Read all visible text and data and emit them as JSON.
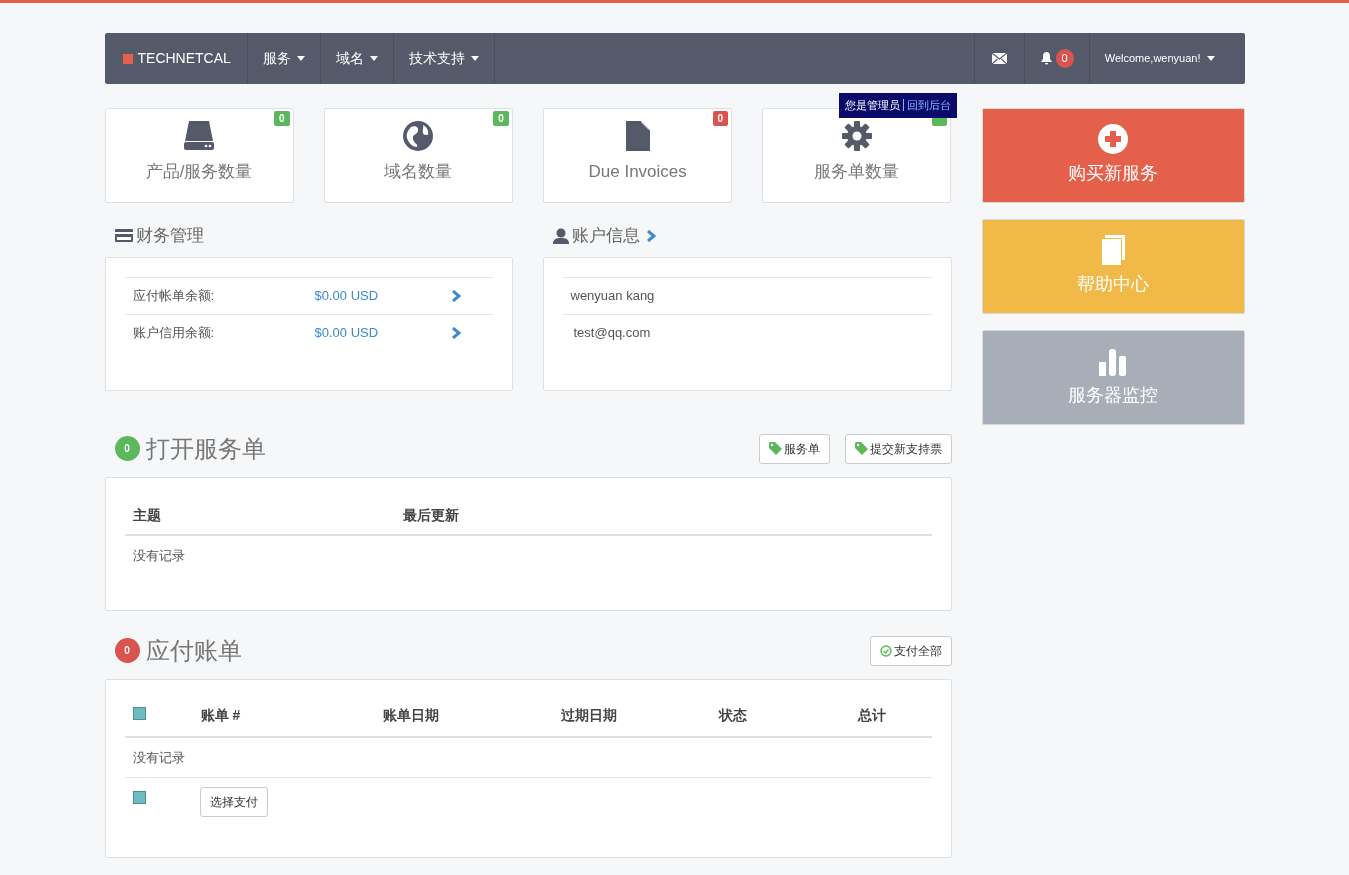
{
  "navbar": {
    "brand": "TECHNETCAL",
    "menus": [
      {
        "label": "服务"
      },
      {
        "label": "域名"
      },
      {
        "label": "技术支持"
      }
    ],
    "notification_count": "0",
    "welcome": "Welcome,wenyuan!"
  },
  "admin_bar": {
    "text": "您是管理员",
    "link": "回到后台"
  },
  "stats": [
    {
      "kind": "drive",
      "label": "产品/服务数量",
      "count": "0",
      "color": "#5cb85c"
    },
    {
      "kind": "globe",
      "label": "域名数量",
      "count": "0",
      "color": "#5cb85c"
    },
    {
      "kind": "file",
      "label": "Due Invoices",
      "count": "0",
      "color": "#d9534f"
    },
    {
      "kind": "gear",
      "label": "服务单数量",
      "color": "#5cb85c"
    }
  ],
  "billing": {
    "title": "财务管理",
    "rows": [
      {
        "label": "应付帐单余额:",
        "amount": "$0.00 USD"
      },
      {
        "label": "账户信用余额:",
        "amount": "$0.00 USD"
      }
    ]
  },
  "account": {
    "title": "账户信息",
    "name": "wenyuan kang",
    "email": "test@qq.com"
  },
  "tickets": {
    "count": "0",
    "color": "#5cb85c",
    "title": "打开服务单",
    "buttons": [
      "服务单",
      "提交新支持票"
    ],
    "columns": [
      "主题",
      "最后更新"
    ],
    "empty": "没有记录"
  },
  "invoices": {
    "count": "0",
    "color": "#d9534f",
    "title": "应付账单",
    "pay_all": "支付全部",
    "select_all_checked": false,
    "columns": [
      "账单 #",
      "账单日期",
      "过期日期",
      "状态",
      "总计"
    ],
    "empty": "没有记录",
    "footer_checked": false,
    "pay_selected": "选择支付"
  },
  "actions": [
    {
      "kind": "plus",
      "label": "购买新服务",
      "color": "#e5604a"
    },
    {
      "kind": "book",
      "label": "帮助中心",
      "color": "#f0b948"
    },
    {
      "kind": "chart",
      "label": "服务器监控",
      "color": "#a8aeb8"
    }
  ]
}
